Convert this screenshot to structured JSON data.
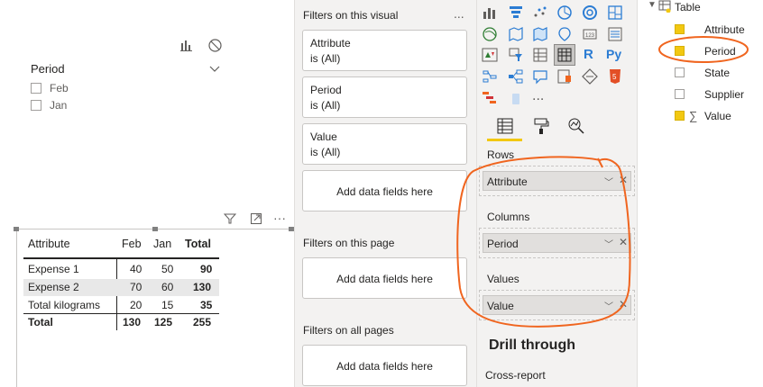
{
  "slicer": {
    "title": "Period",
    "items": [
      "Feb",
      "Jan"
    ]
  },
  "matrix": {
    "headers": [
      "Attribute",
      "Feb",
      "Jan",
      "Total"
    ],
    "rows": [
      {
        "label": "Expense 1",
        "feb": "40",
        "jan": "50",
        "total": "90"
      },
      {
        "label": "Expense 2",
        "feb": "70",
        "jan": "60",
        "total": "130"
      },
      {
        "label": "Total kilograms",
        "feb": "20",
        "jan": "15",
        "total": "35"
      }
    ],
    "total_row": {
      "label": "Total",
      "feb": "130",
      "jan": "125",
      "total": "255"
    }
  },
  "filters": {
    "visual_heading": "Filters on this visual",
    "cards": [
      {
        "name": "Attribute",
        "state": "is (All)"
      },
      {
        "name": "Period",
        "state": "is (All)"
      },
      {
        "name": "Value",
        "state": "is (All)"
      }
    ],
    "add_fields": "Add data fields here",
    "page_heading": "Filters on this page",
    "all_pages_heading": "Filters on all pages",
    "more": "..."
  },
  "viz": {
    "rows_label": "Rows",
    "rows_value": "Attribute",
    "columns_label": "Columns",
    "columns_value": "Period",
    "values_label": "Values",
    "values_value": "Value",
    "drill_through": "Drill through",
    "cross_report": "Cross-report",
    "r_icon": "R",
    "py_icon": "Py",
    "more": "..."
  },
  "fields": {
    "table_name": "Table",
    "items": [
      {
        "label": "Attribute",
        "checked": true
      },
      {
        "label": "Period",
        "checked": true
      },
      {
        "label": "State",
        "checked": false
      },
      {
        "label": "Supplier",
        "checked": false
      },
      {
        "label": "Value",
        "checked": true,
        "sigma": "∑"
      }
    ]
  },
  "colors": {
    "accent_yellow": "#f2c811",
    "annotation_orange": "#f0651f"
  }
}
